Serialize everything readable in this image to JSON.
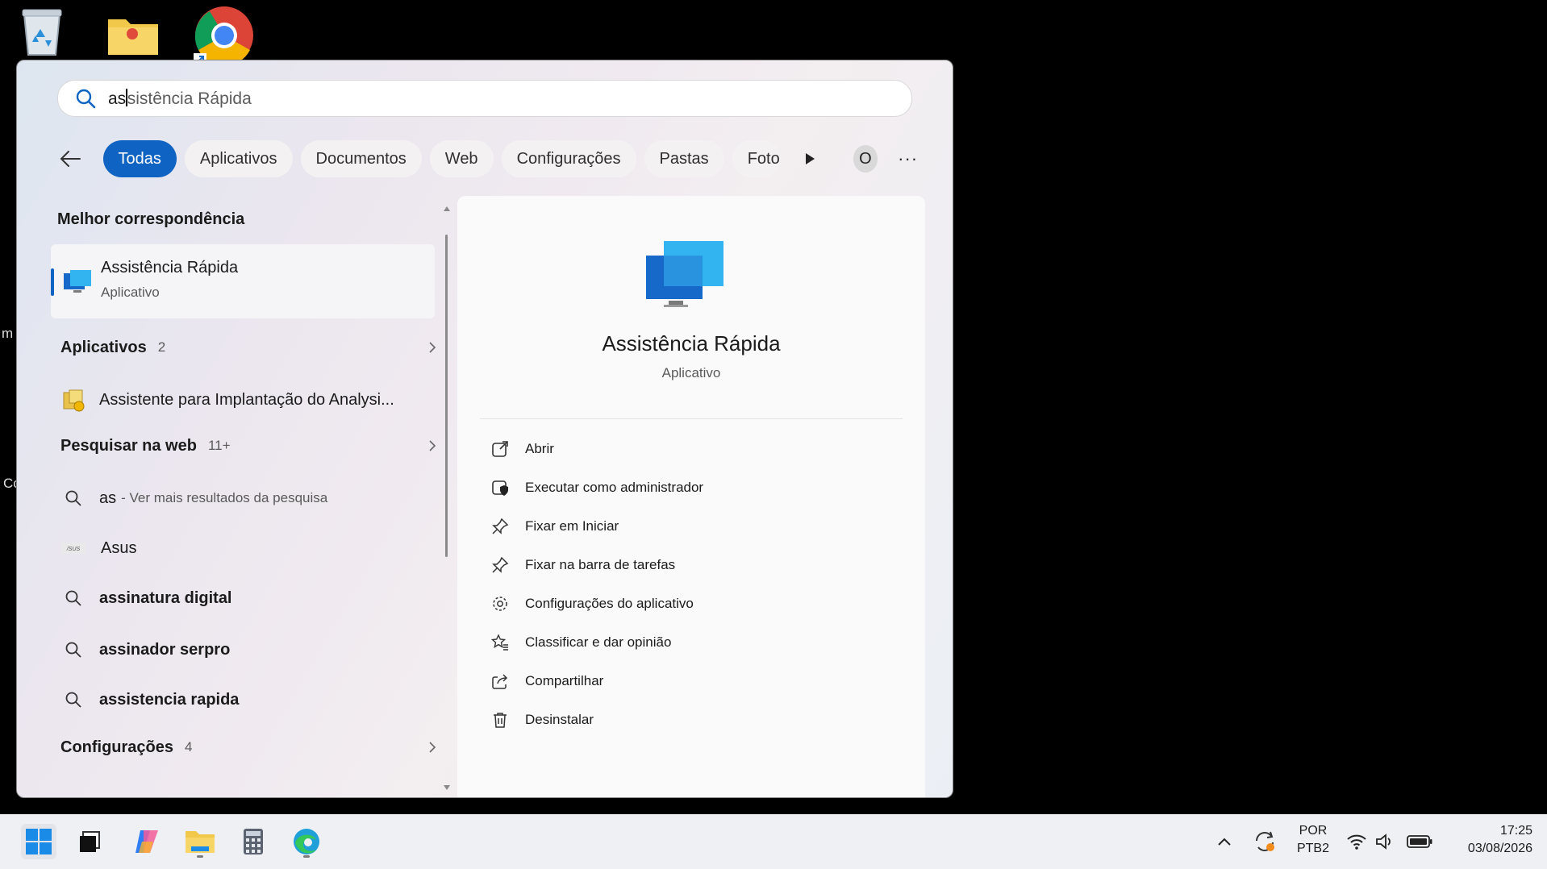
{
  "desktop": {
    "edge_text_1": "m",
    "edge_text_2": "Cc"
  },
  "search": {
    "typed": "as",
    "suggestion_rest": "sistência Rápida"
  },
  "filters": {
    "items": [
      "Todas",
      "Aplicativos",
      "Documentos",
      "Web",
      "Configurações",
      "Pastas",
      "Foto"
    ],
    "avatar_letter": "O",
    "more": "···"
  },
  "results": {
    "best_match_title": "Melhor correspondência",
    "best_match": {
      "name": "Assistência Rápida",
      "type": "Aplicativo"
    },
    "apps_group": {
      "label": "Aplicativos",
      "count": "2"
    },
    "app_item": "Assistente para Implantação do Analysi...",
    "web_group": {
      "label": "Pesquisar na web",
      "count": "11+"
    },
    "web_first": {
      "term": "as",
      "hint": "- Ver mais resultados da pesquisa"
    },
    "asus": "Asus",
    "asus_logo": "/SUS",
    "suggestions": [
      "assinatura digital",
      "assinador serpro",
      "assistencia rapida"
    ],
    "settings_group": {
      "label": "Configurações",
      "count": "4"
    }
  },
  "detail": {
    "name": "Assistência Rápida",
    "type": "Aplicativo",
    "actions": [
      {
        "label": "Abrir",
        "icon": "open-external-icon"
      },
      {
        "label": "Executar como administrador",
        "icon": "shield-admin-icon"
      },
      {
        "label": "Fixar em Iniciar",
        "icon": "pin-icon"
      },
      {
        "label": "Fixar na barra de tarefas",
        "icon": "pin-taskbar-icon"
      },
      {
        "label": "Configurações do aplicativo",
        "icon": "gear-icon"
      },
      {
        "label": "Classificar e dar opinião",
        "icon": "star-feedback-icon"
      },
      {
        "label": "Compartilhar",
        "icon": "share-icon"
      },
      {
        "label": "Desinstalar",
        "icon": "trash-icon"
      }
    ]
  },
  "taskbar": {
    "lang_top": "POR",
    "lang_bottom": "PTB2",
    "time": "17:25",
    "date": "03/08/2026"
  },
  "colors": {
    "accent": "#0f63c2"
  }
}
